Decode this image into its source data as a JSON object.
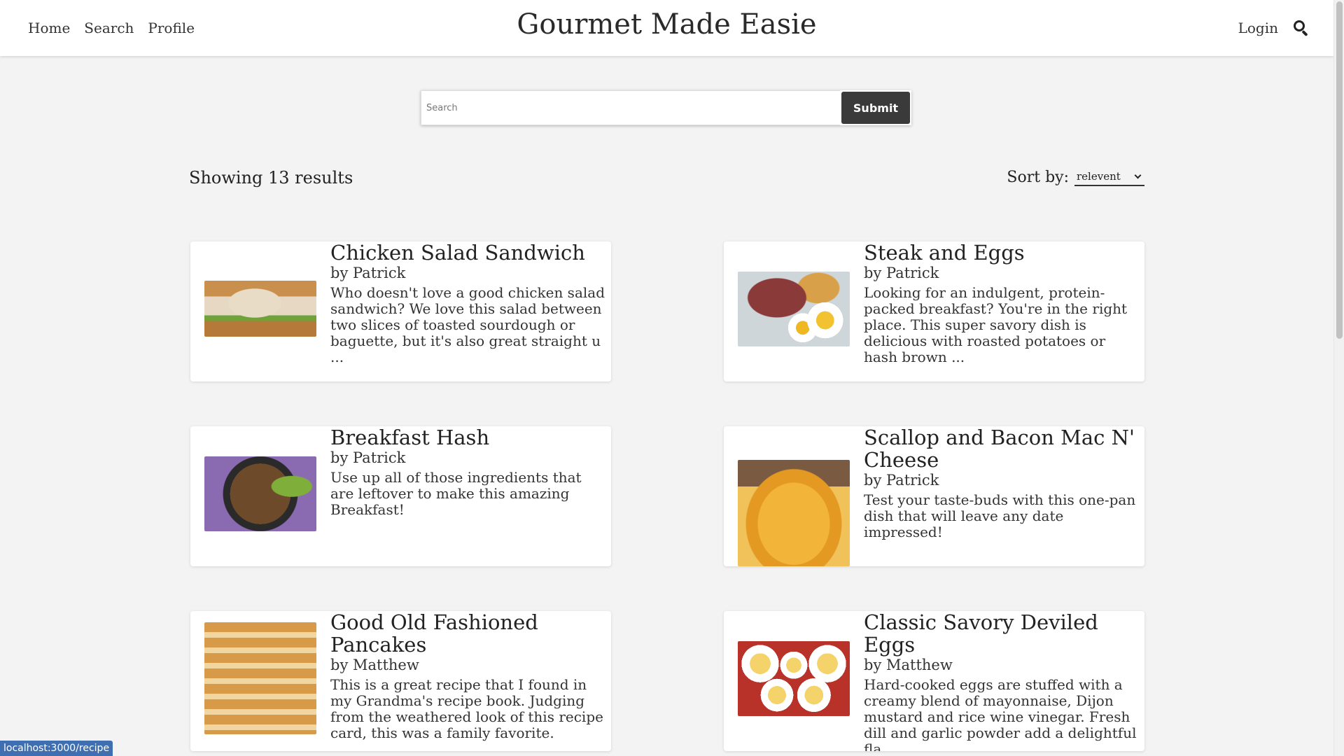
{
  "nav": {
    "home": "Home",
    "search": "Search",
    "profile": "Profile",
    "brand": "Gourmet Made Easie",
    "login": "Login"
  },
  "search": {
    "placeholder": "Search",
    "value": "",
    "submit_label": "Submit"
  },
  "results": {
    "count_text": "Showing 13 results",
    "sort_label": "Sort by:",
    "sort_selected": "relevent"
  },
  "recipes": [
    {
      "title": "Chicken Salad Sandwich",
      "author": "by Patrick",
      "description": "Who doesn't love a good chicken salad sandwich? We love this salad between two slices of toasted sourdough or baguette, but it's also great straight u ..."
    },
    {
      "title": "Steak and Eggs",
      "author": "by Patrick",
      "description": "Looking for an indulgent, protein-packed breakfast? You're in the right place. This super savory dish is delicious with roasted potatoes or hash brown ..."
    },
    {
      "title": "Breakfast Hash",
      "author": "by Patrick",
      "description": "Use up all of those ingredients that are leftover to make this amazing Breakfast!"
    },
    {
      "title": "Scallop and Bacon Mac N' Cheese",
      "author": "by Patrick",
      "description": "Test your taste-buds with this one-pan dish that will leave any date impressed!"
    },
    {
      "title": "Good Old Fashioned Pancakes",
      "author": "by Matthew",
      "description": "This is a great recipe that I found in my Grandma's recipe book. Judging from the weathered look of this recipe card, this was a family favorite."
    },
    {
      "title": "Classic Savory Deviled Eggs",
      "author": "by Matthew",
      "description": "Hard-cooked eggs are stuffed with a creamy blend of mayonnaise, Dijon mustard and rice wine vinegar. Fresh dill and garlic powder add a delightful fla ..."
    }
  ],
  "status_bar": {
    "url": "localhost:3000/recipe"
  }
}
